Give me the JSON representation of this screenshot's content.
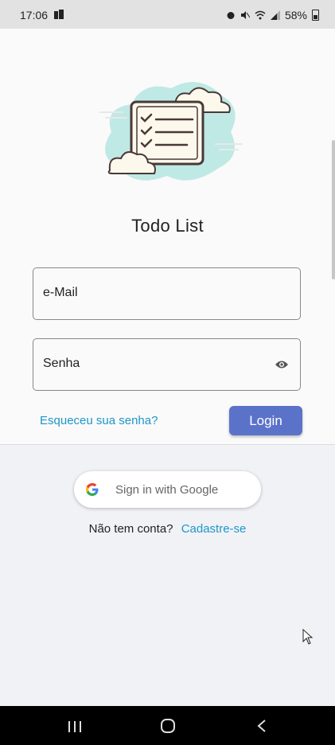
{
  "status_bar": {
    "time": "17:06",
    "battery": "58%",
    "icons": [
      "alarm-icon",
      "mute-icon",
      "wifi-icon",
      "signal-icon",
      "battery-icon"
    ]
  },
  "app": {
    "title": "Todo List",
    "illustration": "checklist-cloud-illustration"
  },
  "login_form": {
    "email_label": "e-Mail",
    "password_label": "Senha",
    "password_toggle_icon": "eye-icon",
    "forgot_password": "Esqueceu sua senha?",
    "login_button": "Login"
  },
  "social": {
    "google_button": "Sign in with Google"
  },
  "signup": {
    "prompt": "Não tem conta?",
    "link": "Cadastre-se"
  },
  "colors": {
    "primary_button": "#5b72c9",
    "link": "#1e96c8",
    "top_background": "#fafafa",
    "bottom_background": "#f1f2f6"
  },
  "nav_bar": {
    "buttons": [
      "recents-icon",
      "home-icon",
      "back-icon"
    ]
  }
}
